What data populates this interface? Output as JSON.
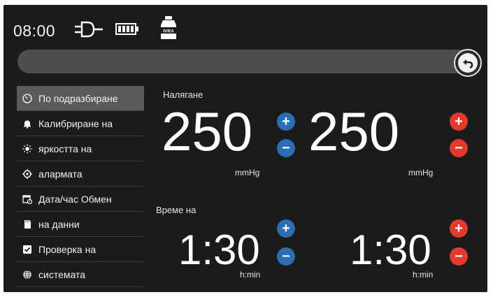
{
  "status": {
    "time": "08:00",
    "bottle_label": "IVRA",
    "icons": [
      "plug-icon",
      "battery-icon",
      "bottle-icon"
    ]
  },
  "menu": {
    "items": [
      {
        "label": "По подразбиране",
        "icon": "gauge-icon",
        "selected": true
      },
      {
        "label": "Калибриране на",
        "icon": "bell-icon",
        "selected": false
      },
      {
        "label": "яркостта на",
        "icon": "brightness-icon",
        "selected": false
      },
      {
        "label": "алармата",
        "icon": "target-icon",
        "selected": false
      },
      {
        "label": "Дата/час Обмен",
        "icon": "calendar-clock-icon",
        "selected": false
      },
      {
        "label": "на данни",
        "icon": "sd-card-icon",
        "selected": false
      },
      {
        "label": "Проверка на",
        "icon": "checkbox-icon",
        "selected": false
      },
      {
        "label": "системата",
        "icon": "globe-icon",
        "selected": false
      }
    ]
  },
  "pressure": {
    "label": "Налягане",
    "left": {
      "value": "250",
      "unit": "mmHg"
    },
    "right": {
      "value": "250",
      "unit": "mmHg"
    }
  },
  "time_section": {
    "label": "Време на",
    "left": {
      "value": "1:30",
      "unit": "h:min"
    },
    "right": {
      "value": "1:30",
      "unit": "h:min"
    }
  },
  "controls": {
    "plus": "+",
    "minus": "−"
  },
  "colors": {
    "background": "#1b1b1b",
    "accent_blue": "#2d6eb3",
    "accent_red": "#e23b2e",
    "selected": "#5a5a5a"
  }
}
